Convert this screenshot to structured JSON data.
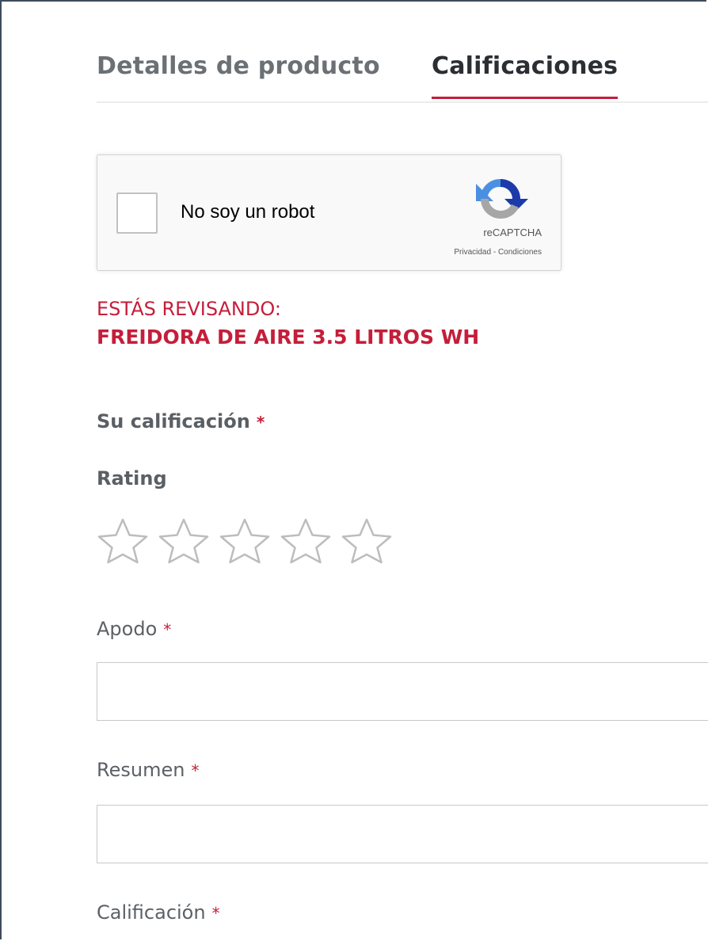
{
  "tabs": [
    {
      "label": "Detalles de producto",
      "active": false
    },
    {
      "label": "Calificaciones",
      "active": true
    }
  ],
  "captcha": {
    "label": "No soy un robot",
    "brand": "reCAPTCHA",
    "privacy": "Privacidad",
    "separator": " - ",
    "terms": "Condiciones",
    "checked": false
  },
  "review": {
    "lead": "ESTÁS REVISANDO:",
    "product": "FREIDORA DE AIRE 3.5 LITROS WH"
  },
  "form": {
    "rating_section_label": "Su calificación",
    "rating_label": "Rating",
    "rating_value": 0,
    "rating_max": 5,
    "required_marker": "*",
    "nickname_label": "Apodo",
    "nickname_value": "",
    "summary_label": "Resumen",
    "summary_value": "",
    "review_label": "Calificación"
  },
  "colors": {
    "accent": "#c41e3a",
    "tab_inactive": "#6b7075",
    "tab_active": "#2b2f33",
    "star_outline": "#bdbdbd",
    "recaptcha_blue": "#1c3aa9",
    "recaptcha_lightblue": "#4a90e2",
    "recaptcha_gray": "#a6a6a6"
  }
}
